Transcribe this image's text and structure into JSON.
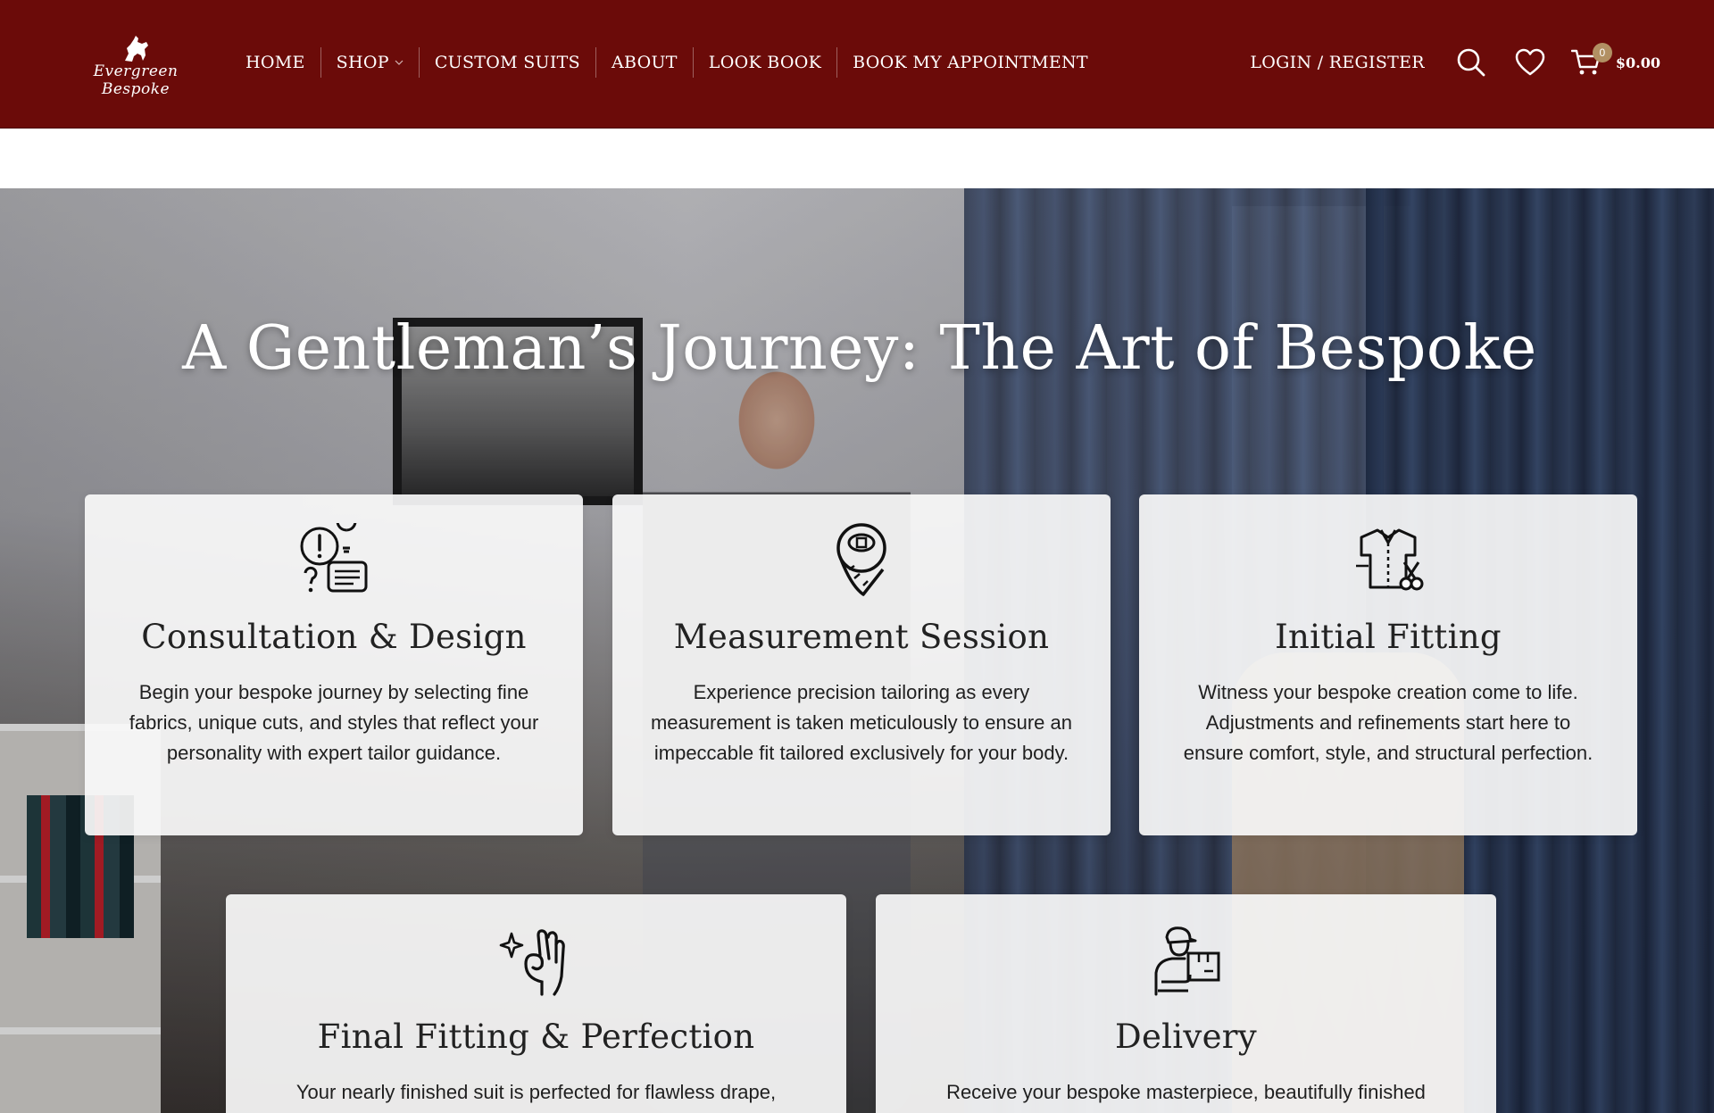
{
  "brand": {
    "logo_text": "Evergreen Bespoke"
  },
  "nav": {
    "items": [
      "HOME",
      "SHOP",
      "CUSTOM SUITS",
      "ABOUT",
      "LOOK BOOK",
      "BOOK MY APPOINTMENT"
    ]
  },
  "header": {
    "login_label": "LOGIN / REGISTER",
    "cart_count": "0",
    "cart_total": "$0.00"
  },
  "colors": {
    "header_bg": "#6b0b09",
    "badge": "#b29063",
    "card_bg": "#fafafa"
  },
  "hero": {
    "title": "A Gentleman’s Journey: The Art of Bespoke"
  },
  "cards": [
    {
      "icon": "consultation-icon",
      "title": "Consultation & Design",
      "text": "Begin your bespoke journey by selecting fine fabrics, unique cuts, and styles that reflect your personality with expert tailor guidance."
    },
    {
      "icon": "measuring-tape-icon",
      "title": "Measurement Session",
      "text": "Experience precision tailoring as every measurement is taken meticulously to ensure an impeccable fit tailored exclusively for your body."
    },
    {
      "icon": "tailored-shirt-icon",
      "title": "Initial Fitting",
      "text": "Witness your bespoke creation come to life. Adjustments and refinements start here to ensure comfort, style, and structural perfection."
    },
    {
      "icon": "ok-hand-icon",
      "title": "Final Fitting & Perfection",
      "text": "Your nearly finished suit is perfected for flawless drape,"
    },
    {
      "icon": "delivery-person-icon",
      "title": "Delivery",
      "text": "Receive your bespoke masterpiece, beautifully finished"
    }
  ]
}
